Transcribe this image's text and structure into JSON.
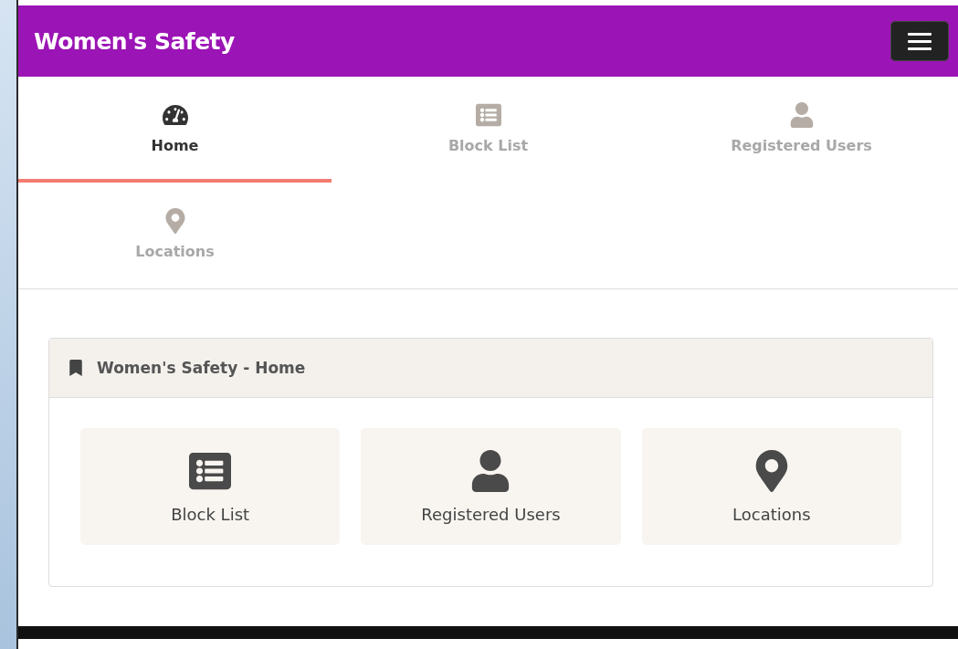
{
  "header": {
    "title": "Women's Safety"
  },
  "tabs": [
    {
      "label": "Home",
      "kind": "dashboard",
      "selected": true
    },
    {
      "label": "Block List",
      "kind": "list",
      "selected": false
    },
    {
      "label": "Registered Users",
      "kind": "user",
      "selected": false
    },
    {
      "label": "Locations",
      "kind": "marker",
      "selected": false
    }
  ],
  "panel": {
    "title": "Women's Safety - Home",
    "tiles": [
      {
        "label": "Block List",
        "kind": "list"
      },
      {
        "label": "Registered Users",
        "kind": "user"
      },
      {
        "label": "Locations",
        "kind": "marker"
      }
    ]
  }
}
